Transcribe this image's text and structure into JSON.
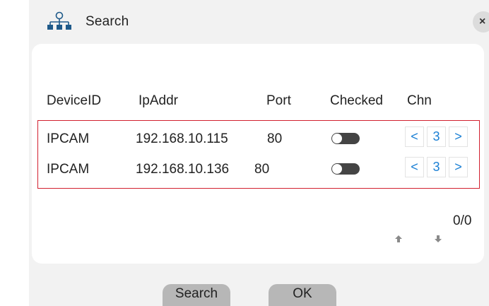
{
  "dialog": {
    "title": "Search",
    "close_label": "×"
  },
  "table": {
    "headers": [
      "DeviceID",
      "IpAddr",
      "Port",
      "Checked",
      "Chn"
    ],
    "rows": [
      {
        "device_id": "IPCAM",
        "ip": "192.168.10.115",
        "port": "80",
        "checked": false,
        "chn": "3",
        "prev": "<",
        "next": ">"
      },
      {
        "device_id": "IPCAM",
        "ip": "192.168.10.136",
        "port": "80",
        "checked": false,
        "chn": "3",
        "prev": "<",
        "next": ">"
      }
    ]
  },
  "pager": {
    "text": "0/0"
  },
  "buttons": {
    "search": "Search",
    "ok": "OK"
  },
  "icons": {
    "title": "network-topology-icon",
    "up": "arrow-up-icon",
    "down": "arrow-down-icon"
  },
  "colors": {
    "accent": "#1a7fd4",
    "selection": "#d2202f"
  }
}
